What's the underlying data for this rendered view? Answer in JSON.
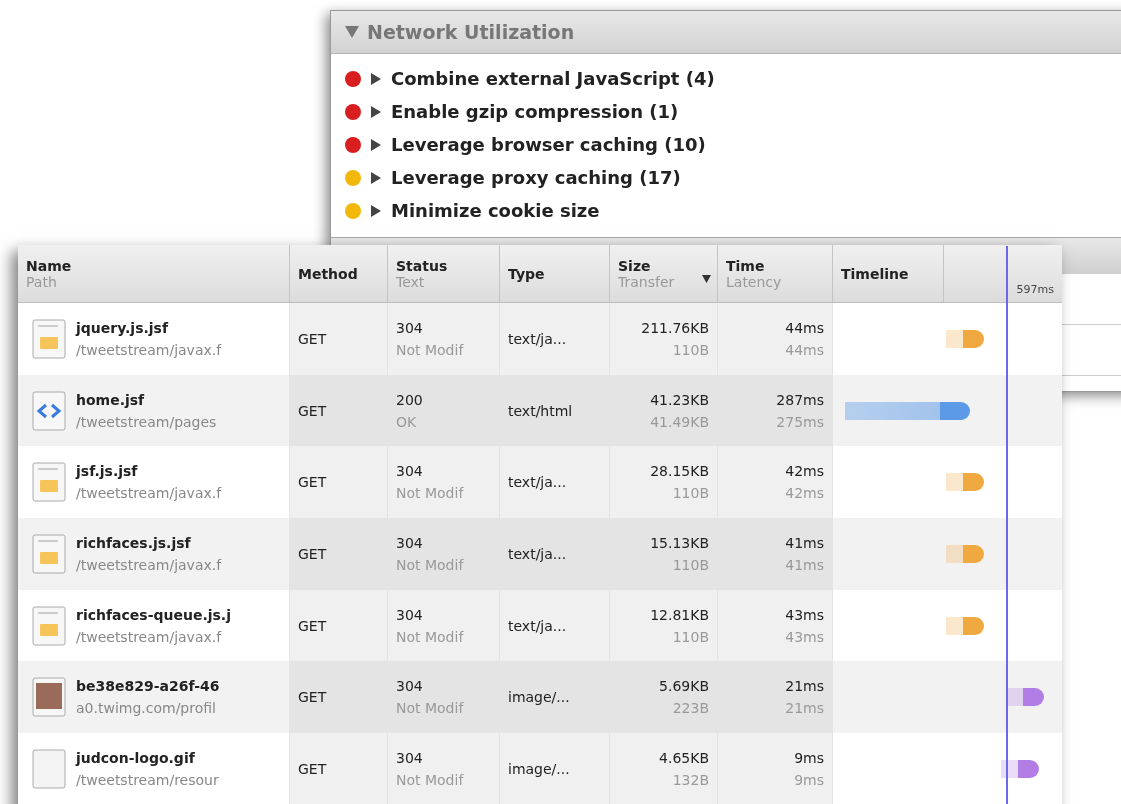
{
  "rules_panel": {
    "title": "Network Utilization",
    "rules": [
      {
        "label": "Combine external JavaScript (4)",
        "color": "#d81e1e"
      },
      {
        "label": "Enable gzip compression (1)",
        "color": "#d81e1e"
      },
      {
        "label": "Leverage browser caching (10)",
        "color": "#d81e1e"
      },
      {
        "label": "Leverage proxy caching (17)",
        "color": "#f2b90c"
      },
      {
        "label": "Minimize cookie size",
        "color": "#f2b90c"
      }
    ]
  },
  "network_table": {
    "columns": [
      {
        "label": "Name",
        "sublabel": "Path"
      },
      {
        "label": "Method"
      },
      {
        "label": "Status",
        "sublabel": "Text"
      },
      {
        "label": "Type"
      },
      {
        "label": "Size",
        "sublabel": "Transfer",
        "sorted": true
      },
      {
        "label": "Time",
        "sublabel": "Latency"
      },
      {
        "label": "Timeline"
      },
      {
        "label": "597ms"
      }
    ],
    "rows": [
      {
        "kind": "js",
        "name": "jquery.js.jsf",
        "path": "/tweetstream/javax.f",
        "method": "GET",
        "status": "304",
        "status_text": "Not Modif",
        "type": "text/ja...",
        "size": "211.76KB",
        "transfer": "110B",
        "time": "44ms",
        "latency": "44ms",
        "timeline": {
          "kind": "dot",
          "color": "#f0a840",
          "level": 0.66
        }
      },
      {
        "kind": "html",
        "name": "home.jsf",
        "path": "/tweetstream/pages",
        "method": "GET",
        "status": "200",
        "status_text": "OK",
        "type": "text/html",
        "size": "41.23KB",
        "transfer": "41.49KB",
        "time": "287ms",
        "latency": "275ms",
        "timeline": {
          "kind": "span",
          "color": "#5c9ae8",
          "level": 0.6
        }
      },
      {
        "kind": "js",
        "name": "jsf.js.jsf",
        "path": "/tweetstream/javax.f",
        "method": "GET",
        "status": "304",
        "status_text": "Not Modif",
        "type": "text/ja...",
        "size": "28.15KB",
        "transfer": "110B",
        "time": "42ms",
        "latency": "42ms",
        "timeline": {
          "kind": "dot",
          "color": "#f0a840",
          "level": 0.66
        }
      },
      {
        "kind": "js",
        "name": "richfaces.js.jsf",
        "path": "/tweetstream/javax.f",
        "method": "GET",
        "status": "304",
        "status_text": "Not Modif",
        "type": "text/ja...",
        "size": "15.13KB",
        "transfer": "110B",
        "time": "41ms",
        "latency": "41ms",
        "timeline": {
          "kind": "dot",
          "color": "#f0a840",
          "level": 0.66
        }
      },
      {
        "kind": "js",
        "name": "richfaces-queue.js.j",
        "path": "/tweetstream/javax.f",
        "method": "GET",
        "status": "304",
        "status_text": "Not Modif",
        "type": "text/ja...",
        "size": "12.81KB",
        "transfer": "110B",
        "time": "43ms",
        "latency": "43ms",
        "timeline": {
          "kind": "dot",
          "color": "#f0a840",
          "level": 0.66
        }
      },
      {
        "kind": "photo",
        "name": "be38e829-a26f-46",
        "path": "a0.twimg.com/profil",
        "method": "GET",
        "status": "304",
        "status_text": "Not Modif",
        "type": "image/...",
        "size": "5.69KB",
        "transfer": "223B",
        "time": "21ms",
        "latency": "21ms",
        "timeline": {
          "kind": "dot",
          "color": "#b27ee6",
          "level": 0.92
        }
      },
      {
        "kind": "image",
        "name": "judcon-logo.gif",
        "path": "/tweetstream/resour",
        "method": "GET",
        "status": "304",
        "status_text": "Not Modif",
        "type": "image/...",
        "size": "4.65KB",
        "transfer": "132B",
        "time": "9ms",
        "latency": "9ms",
        "timeline": {
          "kind": "dot",
          "color": "#b27ee6",
          "level": 0.9
        }
      }
    ]
  }
}
